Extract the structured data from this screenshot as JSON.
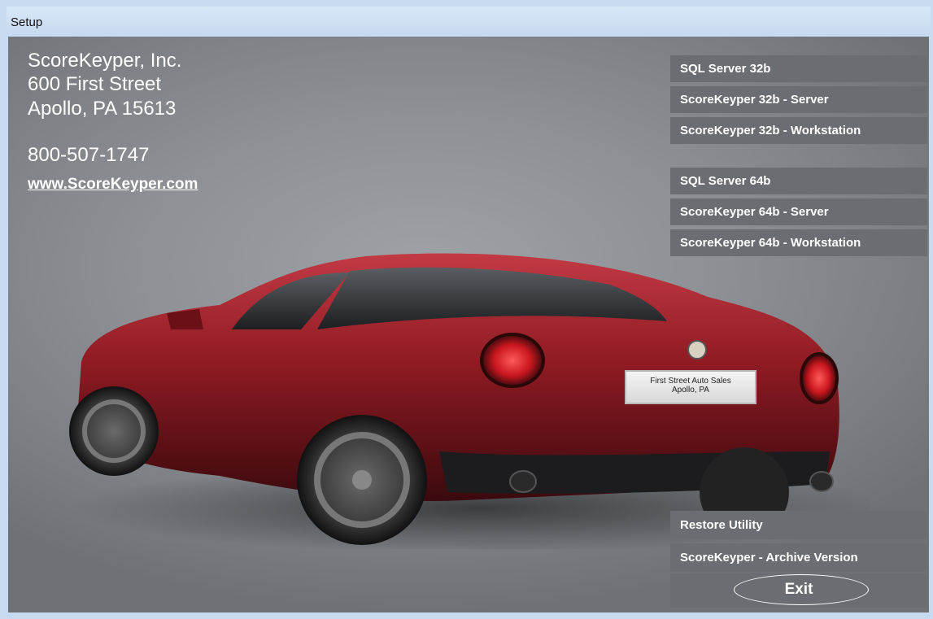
{
  "window": {
    "title": "Setup"
  },
  "company": {
    "name": "ScoreKeyper, Inc.",
    "street": "600 First Street",
    "city": "Apollo, PA 15613",
    "phone": "800-507-1747",
    "website": "www.ScoreKeyper.com"
  },
  "buttons_32": {
    "sql": "SQL Server 32b",
    "server": "ScoreKeyper 32b  - Server",
    "workstation": "ScoreKeyper 32b - Workstation"
  },
  "buttons_64": {
    "sql": "SQL Server 64b",
    "server": "ScoreKeyper 64b  - Server",
    "workstation": "ScoreKeyper 64b - Workstation"
  },
  "utilities": {
    "restore": "Restore Utility",
    "archive": "ScoreKeyper - Archive Version",
    "exit": "Exit"
  },
  "plate": {
    "line1": "First Street Auto Sales",
    "line2": "Apollo, PA"
  },
  "colors": {
    "button_bg": "#6a6d71",
    "car_red": "#8e1a22",
    "background_gray": "#8d9195"
  },
  "icons": {
    "car": "red-sports-car-image"
  }
}
